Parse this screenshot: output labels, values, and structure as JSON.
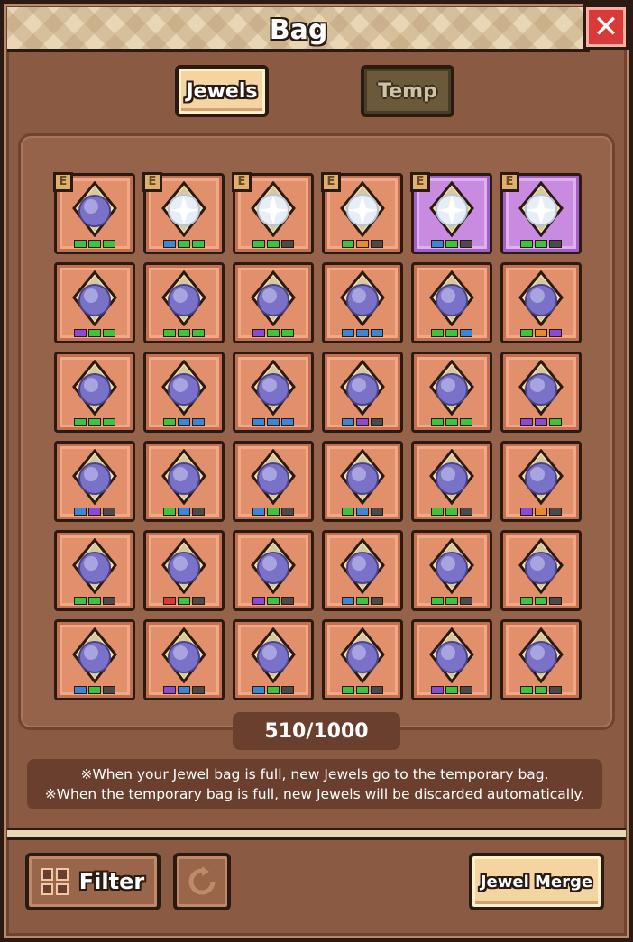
{
  "window": {
    "title": "Bag"
  },
  "tabs": [
    {
      "label": "Jewels",
      "active": true
    },
    {
      "label": "Temp",
      "active": false
    }
  ],
  "colors": {
    "slot_normal": "#e2906c",
    "slot_purple": "#c88be0",
    "dot_green": "#3cc43c",
    "dot_blue": "#3a86d8",
    "dot_purple": "#8a4ad8",
    "dot_gray": "#4a4a4a",
    "dot_orange": "#e88a2a",
    "dot_red": "#d83a3a"
  },
  "grid": {
    "rows": [
      [
        {
          "gem": "purple",
          "equipped": true,
          "rare": false,
          "dots": [
            "green",
            "green",
            "green"
          ]
        },
        {
          "gem": "white",
          "equipped": true,
          "rare": false,
          "dots": [
            "blue",
            "green",
            "green"
          ]
        },
        {
          "gem": "white",
          "equipped": true,
          "rare": false,
          "dots": [
            "green",
            "green",
            "gray"
          ]
        },
        {
          "gem": "white",
          "equipped": true,
          "rare": false,
          "dots": [
            "green",
            "orange",
            "gray"
          ]
        },
        {
          "gem": "white",
          "equipped": true,
          "rare": true,
          "dots": [
            "blue",
            "green",
            "gray"
          ]
        },
        {
          "gem": "white",
          "equipped": true,
          "rare": true,
          "dots": [
            "green",
            "green",
            "gray"
          ]
        }
      ],
      [
        {
          "gem": "purple",
          "equipped": false,
          "rare": false,
          "dots": [
            "purple",
            "green",
            "green"
          ]
        },
        {
          "gem": "purple",
          "equipped": false,
          "rare": false,
          "dots": [
            "green",
            "green",
            "green"
          ]
        },
        {
          "gem": "purple",
          "equipped": false,
          "rare": false,
          "dots": [
            "purple",
            "green",
            "green"
          ]
        },
        {
          "gem": "purple",
          "equipped": false,
          "rare": false,
          "dots": [
            "blue",
            "blue",
            "blue"
          ]
        },
        {
          "gem": "purple",
          "equipped": false,
          "rare": false,
          "dots": [
            "green",
            "green",
            "blue"
          ]
        },
        {
          "gem": "purple",
          "equipped": false,
          "rare": false,
          "dots": [
            "green",
            "orange",
            "purple"
          ]
        }
      ],
      [
        {
          "gem": "purple",
          "equipped": false,
          "rare": false,
          "dots": [
            "green",
            "green",
            "green"
          ]
        },
        {
          "gem": "purple",
          "equipped": false,
          "rare": false,
          "dots": [
            "green",
            "blue",
            "blue"
          ]
        },
        {
          "gem": "purple",
          "equipped": false,
          "rare": false,
          "dots": [
            "blue",
            "blue",
            "blue"
          ]
        },
        {
          "gem": "purple",
          "equipped": false,
          "rare": false,
          "dots": [
            "blue",
            "purple",
            "gray"
          ]
        },
        {
          "gem": "purple",
          "equipped": false,
          "rare": false,
          "dots": [
            "green",
            "green",
            "green"
          ]
        },
        {
          "gem": "purple",
          "equipped": false,
          "rare": false,
          "dots": [
            "purple",
            "purple",
            "green"
          ]
        }
      ],
      [
        {
          "gem": "purple",
          "equipped": false,
          "rare": false,
          "dots": [
            "blue",
            "purple",
            "gray"
          ]
        },
        {
          "gem": "purple",
          "equipped": false,
          "rare": false,
          "dots": [
            "green",
            "blue",
            "gray"
          ]
        },
        {
          "gem": "purple",
          "equipped": false,
          "rare": false,
          "dots": [
            "blue",
            "green",
            "gray"
          ]
        },
        {
          "gem": "purple",
          "equipped": false,
          "rare": false,
          "dots": [
            "green",
            "blue",
            "gray"
          ]
        },
        {
          "gem": "purple",
          "equipped": false,
          "rare": false,
          "dots": [
            "green",
            "green",
            "gray"
          ]
        },
        {
          "gem": "purple",
          "equipped": false,
          "rare": false,
          "dots": [
            "purple",
            "orange",
            "gray"
          ]
        }
      ],
      [
        {
          "gem": "purple",
          "equipped": false,
          "rare": false,
          "dots": [
            "green",
            "green",
            "gray"
          ]
        },
        {
          "gem": "purple",
          "equipped": false,
          "rare": false,
          "dots": [
            "red",
            "green",
            "gray"
          ]
        },
        {
          "gem": "purple",
          "equipped": false,
          "rare": false,
          "dots": [
            "purple",
            "green",
            "gray"
          ]
        },
        {
          "gem": "purple",
          "equipped": false,
          "rare": false,
          "dots": [
            "blue",
            "green",
            "gray"
          ]
        },
        {
          "gem": "purple",
          "equipped": false,
          "rare": false,
          "dots": [
            "green",
            "green",
            "gray"
          ]
        },
        {
          "gem": "purple",
          "equipped": false,
          "rare": false,
          "dots": [
            "green",
            "green",
            "gray"
          ]
        }
      ],
      [
        {
          "gem": "purple",
          "equipped": false,
          "rare": false,
          "dots": [
            "blue",
            "green",
            "gray"
          ]
        },
        {
          "gem": "purple",
          "equipped": false,
          "rare": false,
          "dots": [
            "purple",
            "blue",
            "gray"
          ]
        },
        {
          "gem": "purple",
          "equipped": false,
          "rare": false,
          "dots": [
            "blue",
            "green",
            "gray"
          ]
        },
        {
          "gem": "purple",
          "equipped": false,
          "rare": false,
          "dots": [
            "green",
            "green",
            "gray"
          ]
        },
        {
          "gem": "purple",
          "equipped": false,
          "rare": false,
          "dots": [
            "purple",
            "green",
            "gray"
          ]
        },
        {
          "gem": "purple",
          "equipped": false,
          "rare": false,
          "dots": [
            "green",
            "green",
            "gray"
          ]
        }
      ]
    ],
    "equip_badge": "E"
  },
  "capacity": "510/1000",
  "notice": {
    "line1": "※When your Jewel bag is full, new Jewels go to the temporary bag.",
    "line2": "※When the temporary bag is full, new Jewels will be discarded automatically."
  },
  "bottom": {
    "filter_label": "Filter",
    "merge_label": "Jewel Merge"
  }
}
